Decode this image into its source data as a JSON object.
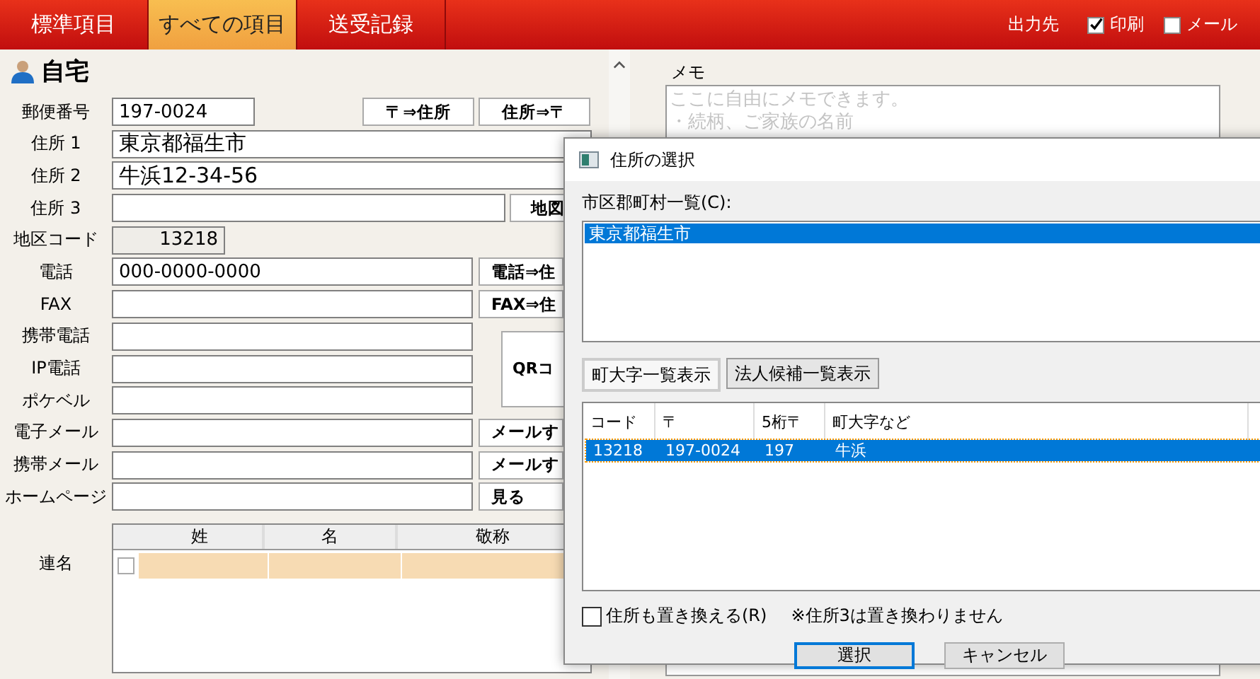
{
  "tabs": [
    {
      "label": "標準項目",
      "selected": false
    },
    {
      "label": "すべての項目",
      "selected": true
    },
    {
      "label": "送受記録",
      "selected": false
    }
  ],
  "output": {
    "label": "出力先",
    "options": [
      {
        "label": "印刷",
        "checked": true
      },
      {
        "label": "メール",
        "checked": false
      }
    ]
  },
  "section_title": "自宅",
  "fields": [
    {
      "kind": "short",
      "label": "郵便番号",
      "value": "197-0024",
      "buttons": [
        "〒⇒住所",
        "住所⇒〒"
      ]
    },
    {
      "kind": "full",
      "label": "住所 1",
      "value": "東京都福生市"
    },
    {
      "kind": "full",
      "label": "住所 2",
      "value": "牛浜12-34-56"
    },
    {
      "kind": "wide",
      "label": "住所 3",
      "buttons": [
        "地図"
      ]
    },
    {
      "kind": "code",
      "label": "地区コード",
      "value": "13218"
    },
    {
      "kind": "medium",
      "label": "電話",
      "value": "000-0000-0000",
      "buttons": [
        "電話⇒住"
      ]
    },
    {
      "kind": "medium",
      "label": "FAX",
      "buttons": [
        "FAX⇒住"
      ]
    },
    {
      "kind": "group",
      "button": "QRコ",
      "rows": [
        {
          "label": "携帯電話"
        },
        {
          "label": "IP電話"
        },
        {
          "label": "ポケベル"
        }
      ]
    },
    {
      "kind": "medium",
      "label": "電子メール",
      "buttons": [
        "メールす"
      ]
    },
    {
      "kind": "medium",
      "label": "携帯メール",
      "buttons": [
        "メールす"
      ]
    },
    {
      "kind": "medium",
      "label": "ホームページ",
      "buttons": [
        "見る"
      ]
    }
  ],
  "joint_names": {
    "label": "連名",
    "columns": [
      "姓",
      "名",
      "敬称"
    ],
    "rows": [
      {
        "checked": false
      }
    ]
  },
  "memo": {
    "label": "メモ",
    "hint_lines": [
      "ここに自由にメモできます。",
      "・続柄、ご家族の名前"
    ]
  },
  "dialog": {
    "title": "住所の選択",
    "list_label": "市区郡町村一覧(C):",
    "list": [
      {
        "label": "東京都福生市",
        "selected": true
      }
    ],
    "view_buttons": [
      {
        "label": "町大字一覧表示",
        "selected": true
      },
      {
        "label": "法人候補一覧表示",
        "selected": false
      }
    ],
    "columns": [
      "コード",
      "〒",
      "5桁〒",
      "町大字など"
    ],
    "rows": [
      {
        "cells": [
          "13218",
          "197-0024",
          "197",
          "牛浜"
        ],
        "selected": true
      }
    ],
    "replace": {
      "label": "住所も置き換える(R)",
      "checked": false
    },
    "note": "※住所3は置き換わりません",
    "buttons": [
      {
        "label": "選択",
        "default": true
      },
      {
        "label": "キャンセル",
        "default": false
      }
    ]
  }
}
